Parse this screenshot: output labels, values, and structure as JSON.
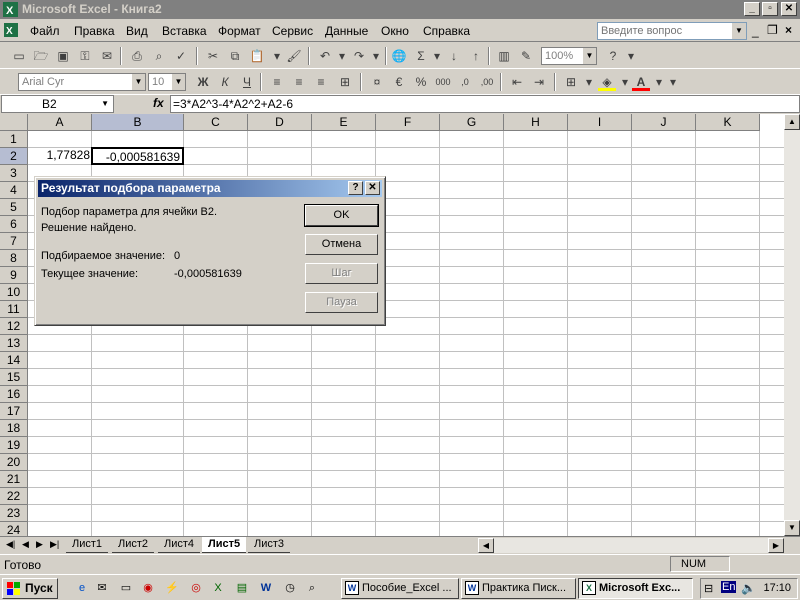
{
  "window": {
    "title": "Microsoft Excel - Книга2"
  },
  "menu": {
    "items": [
      "Файл",
      "Правка",
      "Вид",
      "Вставка",
      "Формат",
      "Сервис",
      "Данные",
      "Окно",
      "Справка"
    ],
    "ask_placeholder": "Введите вопрос"
  },
  "toolbar": {
    "zoom": "100%",
    "font_name": "Arial Cyr",
    "font_size": "10"
  },
  "formula_bar": {
    "name_box": "B2",
    "fx": "fx",
    "formula": "=3*A2^3-4*A2^2+A2-6"
  },
  "grid": {
    "columns": [
      "A",
      "B",
      "C",
      "D",
      "E",
      "F",
      "G",
      "H",
      "I",
      "J",
      "K"
    ],
    "rows": [
      "1",
      "2",
      "3",
      "4",
      "5",
      "6",
      "7",
      "8",
      "9",
      "10",
      "11",
      "12",
      "13",
      "14",
      "15",
      "16",
      "17",
      "18",
      "19",
      "20",
      "21",
      "22",
      "23",
      "24"
    ],
    "cells": {
      "A2": "1,77828",
      "B2": "-0,000581639"
    }
  },
  "sheets": {
    "tabs": [
      "Лист1",
      "Лист2",
      "Лист4",
      "Лист5",
      "Лист3"
    ],
    "active": "Лист5"
  },
  "status": {
    "text": "Готово",
    "num": "NUM"
  },
  "dialog": {
    "title": "Результат подбора параметра",
    "line1": "Подбор параметра для ячейки B2.",
    "line2": "Решение найдено.",
    "target_label": "Подбираемое значение:",
    "target_value": "0",
    "current_label": "Текущее значение:",
    "current_value": "-0,000581639",
    "btn_ok": "OK",
    "btn_cancel": "Отмена",
    "btn_step": "Шаг",
    "btn_pause": "Пауза"
  },
  "taskbar": {
    "start": "Пуск",
    "tasks": [
      "Пособие_Excel ...",
      "Практика Писк...",
      "Microsoft Exc..."
    ],
    "lang": "En",
    "clock": "17:10"
  }
}
